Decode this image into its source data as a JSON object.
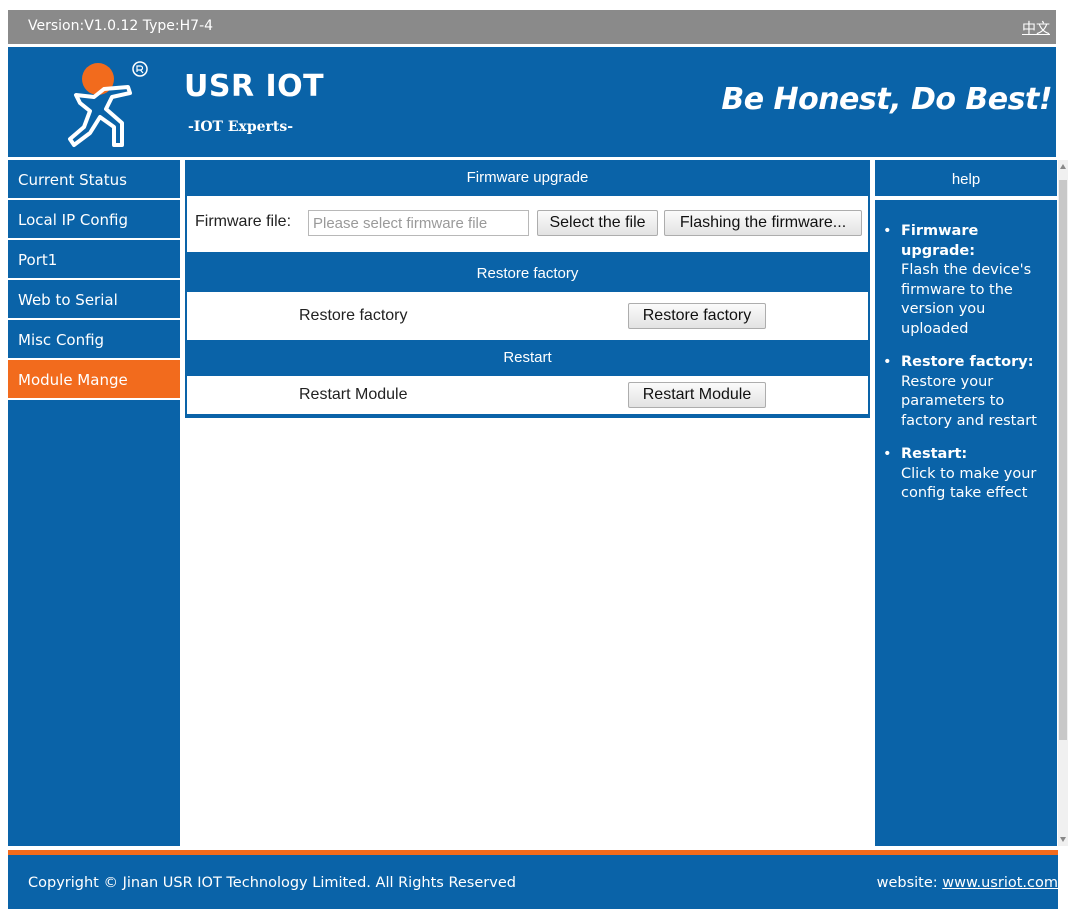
{
  "topbar": {
    "version": "Version:V1.0.12 Type:H7-4",
    "language": "中文"
  },
  "header": {
    "brand": "USR IOT",
    "subtitle": "-IOT Experts-",
    "slogan": "Be Honest, Do Best!",
    "logo_icon": "running-man-logo"
  },
  "colors": {
    "primary": "#0a63a8",
    "accent": "#f26b1d",
    "topbar": "#8a8a8a"
  },
  "sidebar": {
    "items": [
      {
        "label": "Current Status"
      },
      {
        "label": "Local IP Config"
      },
      {
        "label": "Port1"
      },
      {
        "label": "Web to Serial"
      },
      {
        "label": "Misc Config"
      },
      {
        "label": "Module Mange",
        "active": true
      }
    ]
  },
  "firmware": {
    "title": "Firmware upgrade",
    "file_label": "Firmware file:",
    "placeholder": "Please select firmware file",
    "value": "",
    "select_button": "Select the file",
    "flash_button": "Flashing the firmware..."
  },
  "restore": {
    "title": "Restore factory",
    "label": "Restore factory",
    "button": "Restore factory"
  },
  "restart": {
    "title": "Restart",
    "label": "Restart Module",
    "button": "Restart Module"
  },
  "help": {
    "title": "help",
    "items": [
      {
        "term": "Firmware upgrade:",
        "desc": "Flash the device's firmware to the version you uploaded"
      },
      {
        "term": "Restore factory:",
        "desc": "Restore your parameters to factory and restart"
      },
      {
        "term": "Restart:",
        "desc": "Click to make your config take effect"
      }
    ]
  },
  "footer": {
    "copyright": "Copyright © Jinan USR IOT Technology Limited. All Rights Reserved",
    "website_label": "website:",
    "website_link": "www.usriot.com"
  }
}
